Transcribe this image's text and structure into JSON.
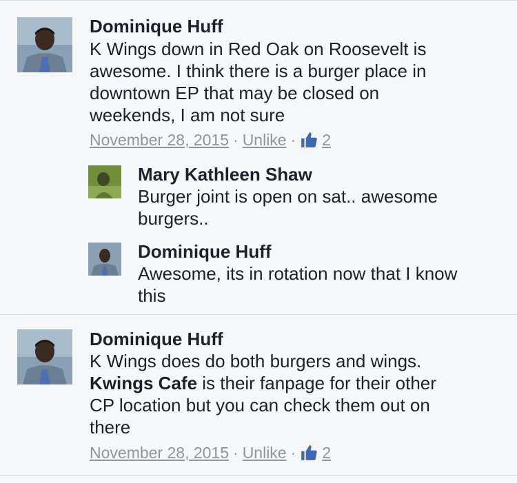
{
  "comments": [
    {
      "author": "Dominique Huff",
      "lines": [
        "K Wings down in Red Oak on Roosevelt is",
        "awesome.  I think there is a burger place in",
        "downtown EP that may be closed on",
        "weekends, I am not sure"
      ],
      "date": "November 28, 2015",
      "separator": "·",
      "action": "Unlike",
      "like_count": "2",
      "replies": [
        {
          "author": "Mary Kathleen Shaw",
          "lines": [
            "Burger joint is open on sat.. awesome",
            "burgers.."
          ]
        },
        {
          "author": "Dominique Huff",
          "lines": [
            "Awesome, its in rotation now that I know",
            "this"
          ]
        }
      ]
    },
    {
      "author": "Dominique Huff",
      "line1": "K Wings does do both burgers and wings.",
      "line2_bold": "Kwings Cafe",
      "line2_rest": " is their fanpage for their other",
      "line3": "CP location but you can check them out on",
      "line4": "there",
      "date": "November 28, 2015",
      "separator": "·",
      "action": "Unlike",
      "like_count": "2"
    }
  ],
  "icons": {
    "like": "thumbs-up-icon"
  },
  "colors": {
    "background": "#f6f7f9",
    "link_meta": "#90949c",
    "like_blue": "#4267b2"
  }
}
